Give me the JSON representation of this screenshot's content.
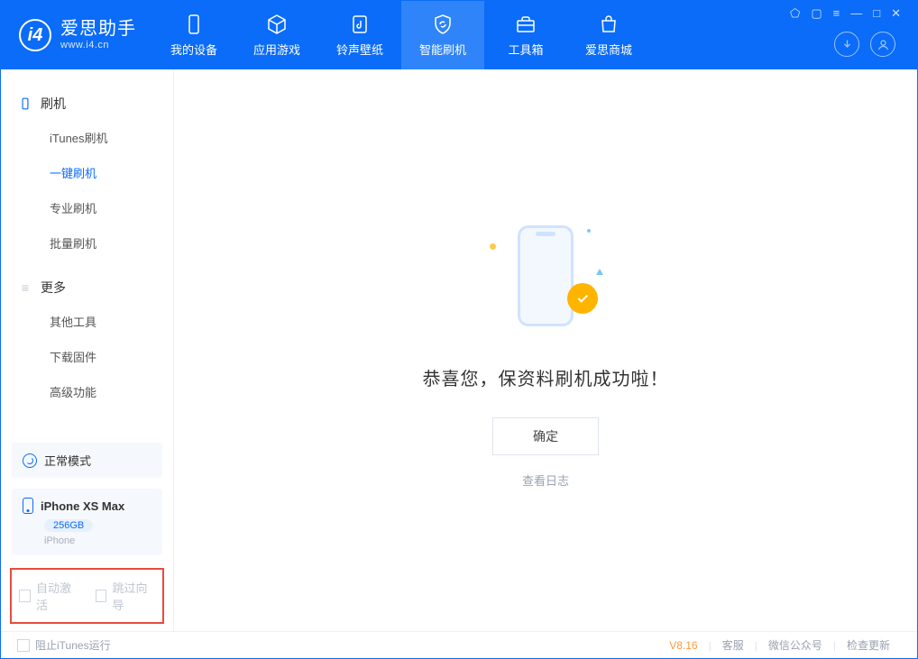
{
  "header": {
    "app_name_cn": "爱思助手",
    "app_name_en": "www.i4.cn",
    "tabs": [
      {
        "label": "我的设备"
      },
      {
        "label": "应用游戏"
      },
      {
        "label": "铃声壁纸"
      },
      {
        "label": "智能刷机"
      },
      {
        "label": "工具箱"
      },
      {
        "label": "爱思商城"
      }
    ]
  },
  "sidebar": {
    "group1_title": "刷机",
    "group1_items": [
      {
        "label": "iTunes刷机"
      },
      {
        "label": "一键刷机"
      },
      {
        "label": "专业刷机"
      },
      {
        "label": "批量刷机"
      }
    ],
    "group2_title": "更多",
    "group2_items": [
      {
        "label": "其他工具"
      },
      {
        "label": "下载固件"
      },
      {
        "label": "高级功能"
      }
    ],
    "mode_card": {
      "label": "正常模式"
    },
    "device_card": {
      "name": "iPhone XS Max",
      "capacity": "256GB",
      "brand": "iPhone"
    },
    "checkboxes": {
      "auto_activate": "自动激活",
      "skip_guide": "跳过向导"
    }
  },
  "main": {
    "message": "恭喜您，保资料刷机成功啦！",
    "ok_button": "确定",
    "log_link": "查看日志"
  },
  "footer": {
    "stop_itunes": "阻止iTunes运行",
    "version": "V8.16",
    "links": {
      "service": "客服",
      "wechat": "微信公众号",
      "update": "检查更新"
    }
  }
}
